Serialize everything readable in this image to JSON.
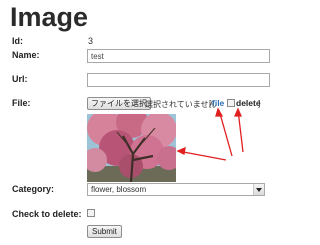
{
  "page": {
    "title": "Image"
  },
  "form": {
    "id": {
      "label": "Id:",
      "value": "3"
    },
    "name": {
      "label": "Name:",
      "value": "test"
    },
    "url": {
      "label": "Url:",
      "value": ""
    },
    "file": {
      "label": "File:",
      "button_label": "ファイルを選択",
      "status_text": "選択されていません",
      "open_bracket": "[",
      "link_text": "file",
      "delete_text": "delete",
      "close_bracket": "]"
    },
    "category": {
      "label": "Category:",
      "selected": "flower, blossom"
    },
    "check_delete": {
      "label": "Check to delete:"
    },
    "submit_label": "Submit"
  },
  "annotation": {
    "arrow_color": "#e02020"
  }
}
